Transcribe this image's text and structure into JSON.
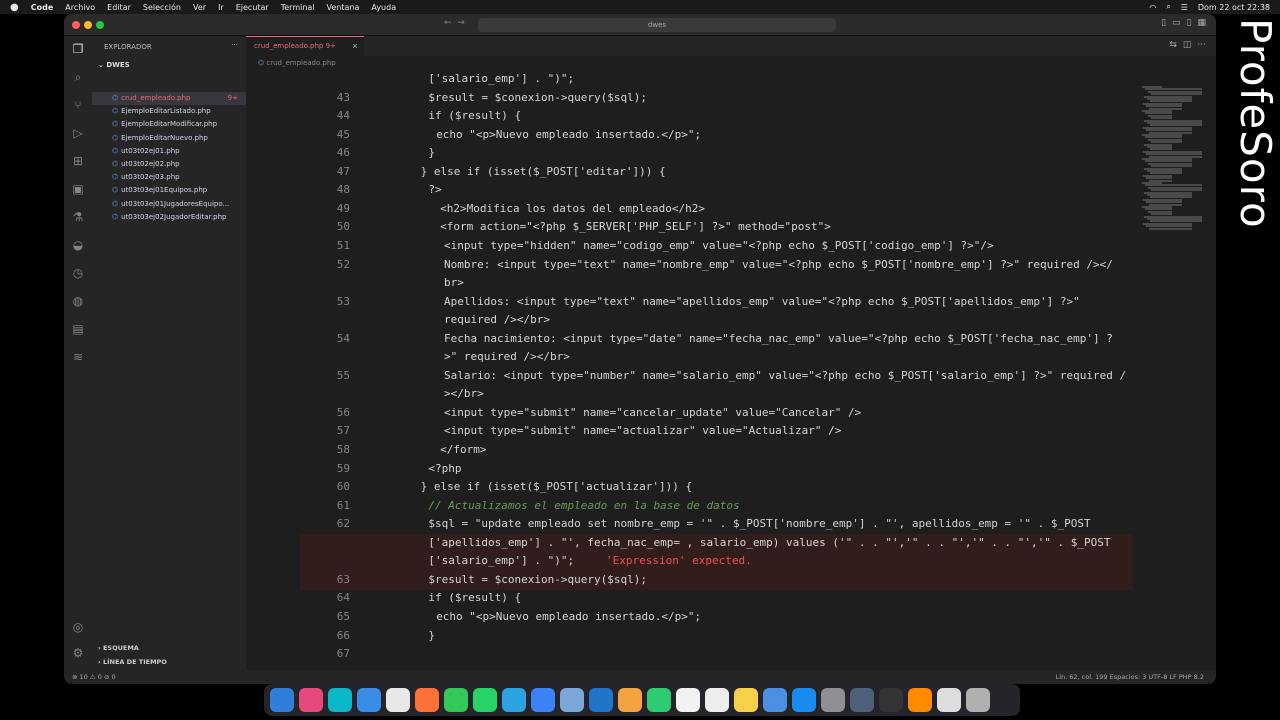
{
  "menubar": {
    "apple": "",
    "items": [
      "Code",
      "Archivo",
      "Editar",
      "Selección",
      "Ver",
      "Ir",
      "Ejecutar",
      "Terminal",
      "Ventana",
      "Ayuda"
    ],
    "datetime": "Dom 22 oct 22:38"
  },
  "titlebar": {
    "search": "dwes"
  },
  "sidebar": {
    "header": "EXPLORADOR",
    "folder": "DWES",
    "files": [
      {
        "name": "crud_empleado.php",
        "badge": "9+",
        "active": true
      },
      {
        "name": "EjemploEditarListado.php"
      },
      {
        "name": "EjemploEditarModificar.php"
      },
      {
        "name": "EjemploEditarNuevo.php"
      },
      {
        "name": "ut03t02ej01.php"
      },
      {
        "name": "ut03t02ej02.php"
      },
      {
        "name": "ut03t02ej03.php"
      },
      {
        "name": "ut03t03ej01Equipos.php"
      },
      {
        "name": "ut03t03ej01JugadoresEquipo..."
      },
      {
        "name": "ut03t03ej02JugadorEditar.php"
      }
    ],
    "outline": "ESQUEMA",
    "timeline": "LÍNEA DE TIEMPO"
  },
  "tab": {
    "label": "crud_empleado.php 9+",
    "close": "×"
  },
  "breadcrumb": "crud_empleado.php",
  "editor": {
    "line_numbers": [
      "",
      "43",
      "44",
      "45",
      "46",
      "47",
      "48",
      "49",
      "50",
      "51",
      "52",
      "",
      "53",
      "",
      "54",
      "",
      "55",
      "",
      "56",
      "57",
      "58",
      "59",
      "60",
      "61",
      "62",
      "",
      "",
      "63",
      "64",
      "65",
      "66",
      "67"
    ],
    "lines": [
      "['salario_emp'] . \")\";",
      "$result = $conexion->query($sql);",
      "if ($result) {",
      "echo \"<p>Nuevo empleado insertado.</p>\";",
      "}",
      "} else if (isset($_POST['editar'])) {",
      "?>",
      "<h2>Modifica los datos del empleado</h2>",
      "<form action=\"<?php $_SERVER['PHP_SELF'] ?>\" method=\"post\">",
      "<input type=\"hidden\" name=\"codigo_emp\" value=\"<?php echo $_POST['codigo_emp'] ?>\"/>",
      "Nombre: <input type=\"text\" name=\"nombre_emp\" value=\"<?php echo $_POST['nombre_emp'] ?>\" required /></",
      "br>",
      "Apellidos: <input type=\"text\" name=\"apellidos_emp\" value=\"<?php echo $_POST['apellidos_emp'] ?>\"",
      "required /></br>",
      "Fecha nacimiento: <input type=\"date\" name=\"fecha_nac_emp\" value=\"<?php echo $_POST['fecha_nac_emp'] ?",
      ">\" required /></br>",
      "Salario: <input type=\"number\" name=\"salario_emp\" value=\"<?php echo $_POST['salario_emp'] ?>\" required /",
      "></br>",
      "<input type=\"submit\" name=\"cancelar_update\" value=\"Cancelar\" />",
      "<input type=\"submit\" name=\"actualizar\" value=\"Actualizar\" />",
      "</form>",
      "<?php",
      "} else if (isset($_POST['actualizar'])) {",
      "// Actualizamos el empleado en la base de datos",
      "$sql = \"update empleado set nombre_emp = '\" . $_POST['nombre_emp'] . \"', apellidos_emp = '\" . $_POST",
      "['apellidos_emp'] . \"', fecha_nac_emp= , salario_emp) values ('\" . . \"','\" . . \"','\" . . \"','\" . $_POST",
      "['salario_emp'] . \")\";",
      "$result = $conexion->query($sql);",
      "if ($result) {",
      "echo \"<p>Nuevo empleado insertado.</p>\";",
      "}",
      ""
    ],
    "error_message": "'Expression' expected."
  },
  "statusbar": {
    "left": "⊗ 10 ⚠ 0   ⊘ 0",
    "right": "Lín. 62, col. 199   Espacios: 3   UTF-8   LF   PHP   8.2"
  },
  "watermark": "ProfeSoro",
  "colors": {
    "accent_tab": "#e06c75",
    "keyword": "#c586c0",
    "variable": "#9cdcfe",
    "string": "#ce9178",
    "tag": "#569cd6",
    "attribute": "#d7ba7d",
    "comment": "#6a9955"
  }
}
